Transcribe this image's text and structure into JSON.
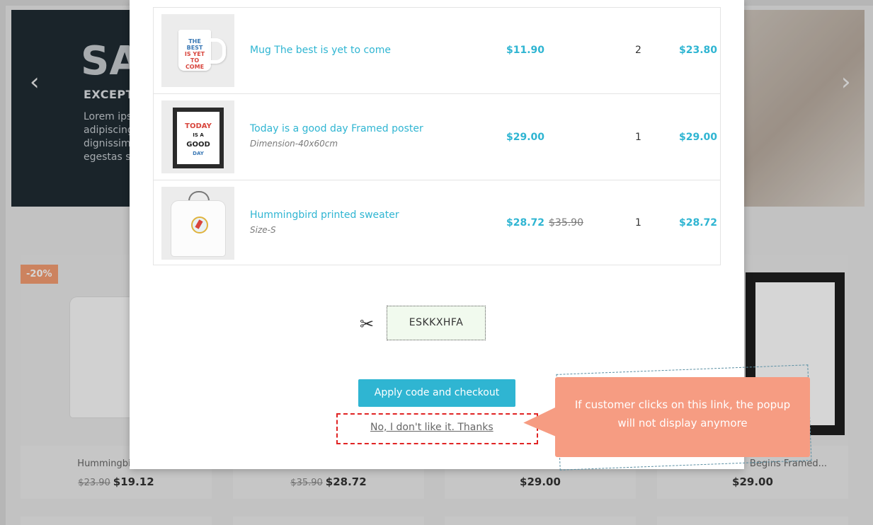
{
  "background": {
    "hero": {
      "title": "SA",
      "subtitle": "EXCEPT",
      "text_lines": [
        "Lorem ips",
        "adipiscing",
        "dignissim",
        "egestas s"
      ],
      "prev_icon": "chevron-left-icon",
      "next_icon": "chevron-right-icon"
    },
    "products": [
      {
        "badge": "-20%",
        "name": "Hummingbird Pri",
        "old_price": "$23.90",
        "price": "$19.12"
      },
      {
        "name": "",
        "old_price": "$35.90",
        "price": "$28.72"
      },
      {
        "name": "",
        "price": "$29.00"
      },
      {
        "name": "Begins Framed...",
        "price": "$29.00"
      }
    ]
  },
  "modal": {
    "cart_items": [
      {
        "name": "Mug The best is yet to come",
        "attribute": "",
        "unit_price": "$11.90",
        "regular_price": "",
        "quantity": "2",
        "total": "$23.80",
        "thumb_text": [
          "THE BEST",
          "IS YET TO",
          "COME"
        ]
      },
      {
        "name": "Today is a good day Framed poster",
        "attribute": "Dimension-40x60cm",
        "unit_price": "$29.00",
        "regular_price": "",
        "quantity": "1",
        "total": "$29.00",
        "thumb_text": [
          "TODAY",
          "IS A",
          "GOOD",
          "DAY"
        ]
      },
      {
        "name": "Hummingbird printed sweater",
        "attribute": "Size-S",
        "unit_price": "$28.72",
        "regular_price": "$35.90",
        "quantity": "1",
        "total": "$28.72"
      }
    ],
    "coupon": {
      "code": "ESKKXHFA",
      "icon": "scissors-icon"
    },
    "apply_button": "Apply code and checkout",
    "decline_link": "No, I don't like it. Thanks"
  },
  "callout": {
    "text": "If customer clicks on this link, the popup will not display anymore",
    "highlight_color": "#e02424",
    "callout_color": "#f69c82"
  },
  "colors": {
    "accent": "#2fb5d2",
    "badge": "#f39d72"
  }
}
